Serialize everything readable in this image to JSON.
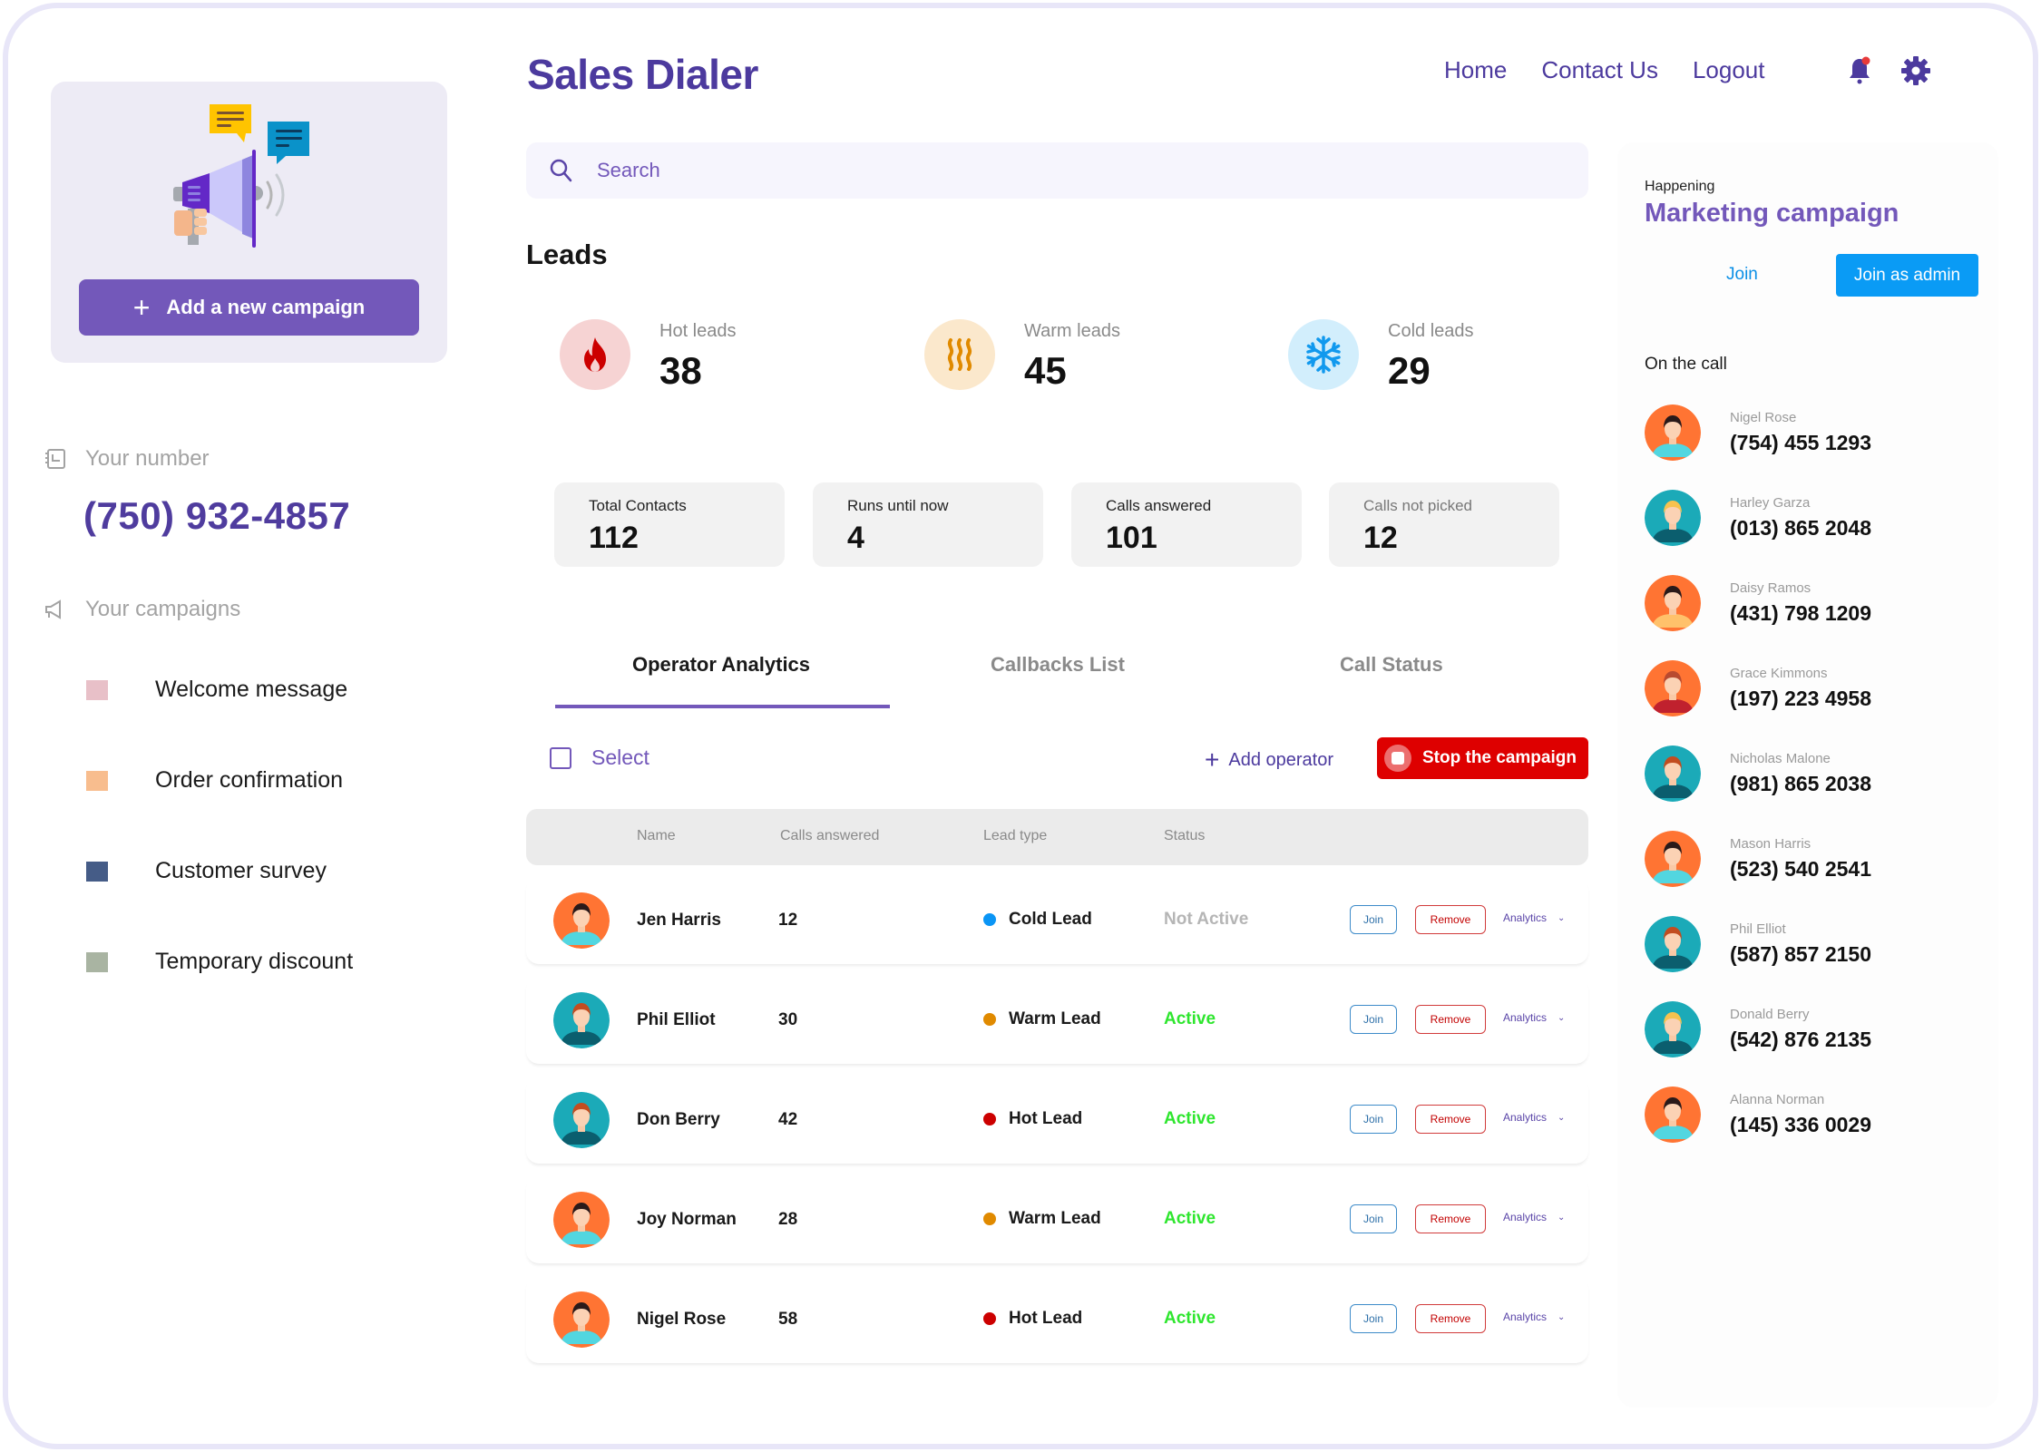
{
  "app": {
    "title": "Sales Dialer"
  },
  "nav": {
    "items": [
      "Home",
      "Contact Us",
      "Logout"
    ],
    "notification_icon": "bell-icon",
    "settings_icon": "gear-icon"
  },
  "sidebar": {
    "add_campaign_label": "Add a new campaign",
    "your_number_label": "Your number",
    "your_number": "(750) 932-4857",
    "your_campaigns_label": "Your campaigns",
    "campaigns": [
      {
        "label": "Welcome message",
        "color": "#E8C0C8"
      },
      {
        "label": "Order confirmation",
        "color": "#F8BD8E"
      },
      {
        "label": "Customer survey",
        "color": "#455C87"
      },
      {
        "label": "Temporary discount",
        "color": "#A9B4A2"
      }
    ]
  },
  "search": {
    "placeholder": "Search",
    "value": ""
  },
  "leads": {
    "title": "Leads",
    "summary": [
      {
        "label": "Hot leads",
        "value": "38",
        "icon": "flame-icon",
        "bg": "#F6D3D3",
        "fg": "#CC0000"
      },
      {
        "label": "Warm leads",
        "value": "45",
        "icon": "heat-waves-icon",
        "bg": "#FBE8CC",
        "fg": "#E08A00"
      },
      {
        "label": "Cold leads",
        "value": "29",
        "icon": "snowflake-icon",
        "bg": "#D2EEFC",
        "fg": "#1199EE"
      }
    ],
    "stats": [
      {
        "label": "Total Contacts",
        "value": "112"
      },
      {
        "label": "Runs until now",
        "value": "4"
      },
      {
        "label": "Calls answered",
        "value": "101"
      },
      {
        "label": "Calls not picked",
        "value": "12"
      }
    ]
  },
  "tabs": [
    {
      "label": "Operator Analytics",
      "active": true
    },
    {
      "label": "Callbacks List",
      "active": false
    },
    {
      "label": "Call Status",
      "active": false
    }
  ],
  "toolbar": {
    "select_label": "Select",
    "add_operator_label": "Add operator",
    "stop_label": "Stop the campaign"
  },
  "table": {
    "columns": [
      "Name",
      "Calls answered",
      "Lead type",
      "Status"
    ],
    "action_labels": {
      "join": "Join",
      "remove": "Remove",
      "analytics": "Analytics"
    },
    "rows": [
      {
        "name": "Jen Harris",
        "calls": "12",
        "lead": "Cold Lead",
        "lead_color": "#0A95F5",
        "status": "Not Active",
        "status_color": "#B5B5B5"
      },
      {
        "name": "Phil Elliot",
        "calls": "30",
        "lead": "Warm Lead",
        "lead_color": "#E08A00",
        "status": "Active",
        "status_color": "#2EE62E"
      },
      {
        "name": "Don Berry",
        "calls": "42",
        "lead": "Hot Lead",
        "lead_color": "#CC0000",
        "status": "Active",
        "status_color": "#2EE62E"
      },
      {
        "name": "Joy Norman",
        "calls": "28",
        "lead": "Warm Lead",
        "lead_color": "#E08A00",
        "status": "Active",
        "status_color": "#2EE62E"
      },
      {
        "name": "Nigel Rose",
        "calls": "58",
        "lead": "Hot Lead",
        "lead_color": "#CC0000",
        "status": "Active",
        "status_color": "#2EE62E"
      }
    ]
  },
  "right_panel": {
    "happening_label": "Happening",
    "campaign_title": "Marketing campaign",
    "join_label": "Join",
    "join_admin_label": "Join as admin",
    "on_call_label": "On the call",
    "callers": [
      {
        "name": "Nigel Rose",
        "phone": "(754) 455 1293"
      },
      {
        "name": "Harley Garza",
        "phone": "(013) 865 2048"
      },
      {
        "name": "Daisy Ramos",
        "phone": "(431) 798 1209"
      },
      {
        "name": "Grace Kimmons",
        "phone": "(197) 223 4958"
      },
      {
        "name": "Nicholas Malone",
        "phone": "(981) 865 2038"
      },
      {
        "name": "Mason Harris",
        "phone": "(523) 540 2541"
      },
      {
        "name": "Phil Elliot",
        "phone": "(587) 857 2150"
      },
      {
        "name": "Donald Berry",
        "phone": "(542) 876 2135"
      },
      {
        "name": "Alanna Norman",
        "phone": "(145) 336 0029"
      }
    ]
  }
}
